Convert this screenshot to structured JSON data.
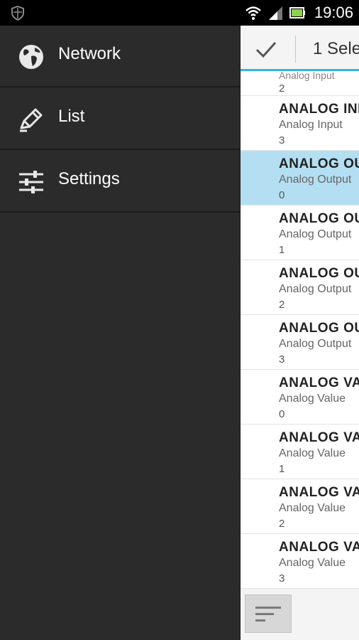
{
  "status_bar": {
    "time": "19:06",
    "icons": [
      "shield-icon",
      "wifi-icon",
      "signal-icon",
      "battery-icon"
    ]
  },
  "drawer": {
    "items": [
      {
        "label": "Network",
        "icon": "globe-icon"
      },
      {
        "label": "List",
        "icon": "pencil-icon"
      },
      {
        "label": "Settings",
        "icon": "sliders-icon"
      }
    ]
  },
  "action_bar": {
    "title": "1 Sele",
    "done_icon": "check-icon"
  },
  "list": {
    "partial_top": {
      "type": "Analog Input",
      "instance": "2"
    },
    "rows": [
      {
        "name": "ANALOG INP",
        "type": "Analog Input",
        "instance": "3",
        "selected": false
      },
      {
        "name": "ANALOG OU",
        "type": "Analog Output",
        "instance": "0",
        "selected": true
      },
      {
        "name": "ANALOG OU",
        "type": "Analog Output",
        "instance": "1",
        "selected": false
      },
      {
        "name": "ANALOG OU",
        "type": "Analog Output",
        "instance": "2",
        "selected": false
      },
      {
        "name": "ANALOG OU",
        "type": "Analog Output",
        "instance": "3",
        "selected": false
      },
      {
        "name": "ANALOG VA",
        "type": "Analog Value",
        "instance": "0",
        "selected": false
      },
      {
        "name": "ANALOG VA",
        "type": "Analog Value",
        "instance": "1",
        "selected": false
      },
      {
        "name": "ANALOG VA",
        "type": "Analog Value",
        "instance": "2",
        "selected": false
      },
      {
        "name": "ANALOG VA",
        "type": "Analog Value",
        "instance": "3",
        "selected": false
      }
    ]
  },
  "bottom_bar": {
    "sort_icon": "sort-icon"
  },
  "colors": {
    "accent": "#33b5e5",
    "selected_row": "#b4dff2",
    "drawer_bg": "#2b2b2b"
  }
}
